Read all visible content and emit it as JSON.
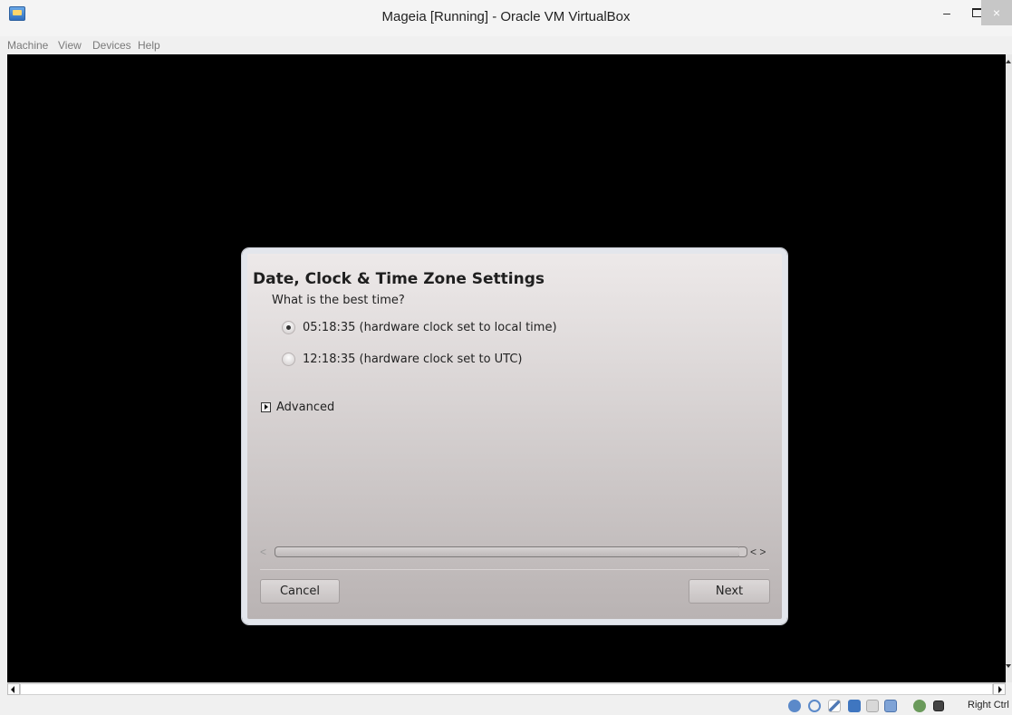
{
  "window": {
    "title": "Mageia [Running] - Oracle VM VirtualBox",
    "controls": {
      "minimize": "–",
      "close": "×"
    }
  },
  "menu": [
    "Machine",
    "View",
    "Devices",
    "Help"
  ],
  "dialog": {
    "title": "Date, Clock & Time Zone Settings",
    "question": "What is the best time?",
    "options": [
      {
        "label": "05:18:35 (hardware clock set to local time)",
        "checked": true
      },
      {
        "label": "12:18:35 (hardware clock set to UTC)",
        "checked": false
      }
    ],
    "advanced_label": "Advanced",
    "progress_left": "<",
    "progress_right": "< >",
    "cancel_label": "Cancel",
    "next_label": "Next"
  },
  "statusbar": {
    "host_key_label": "Right Ctrl",
    "icons": [
      "hard-disk-icon",
      "optical-drive-icon",
      "usb-icon",
      "network-icon",
      "shared-folders-icon",
      "display-icon",
      "capture-icon",
      "mouse-integration-icon"
    ]
  }
}
